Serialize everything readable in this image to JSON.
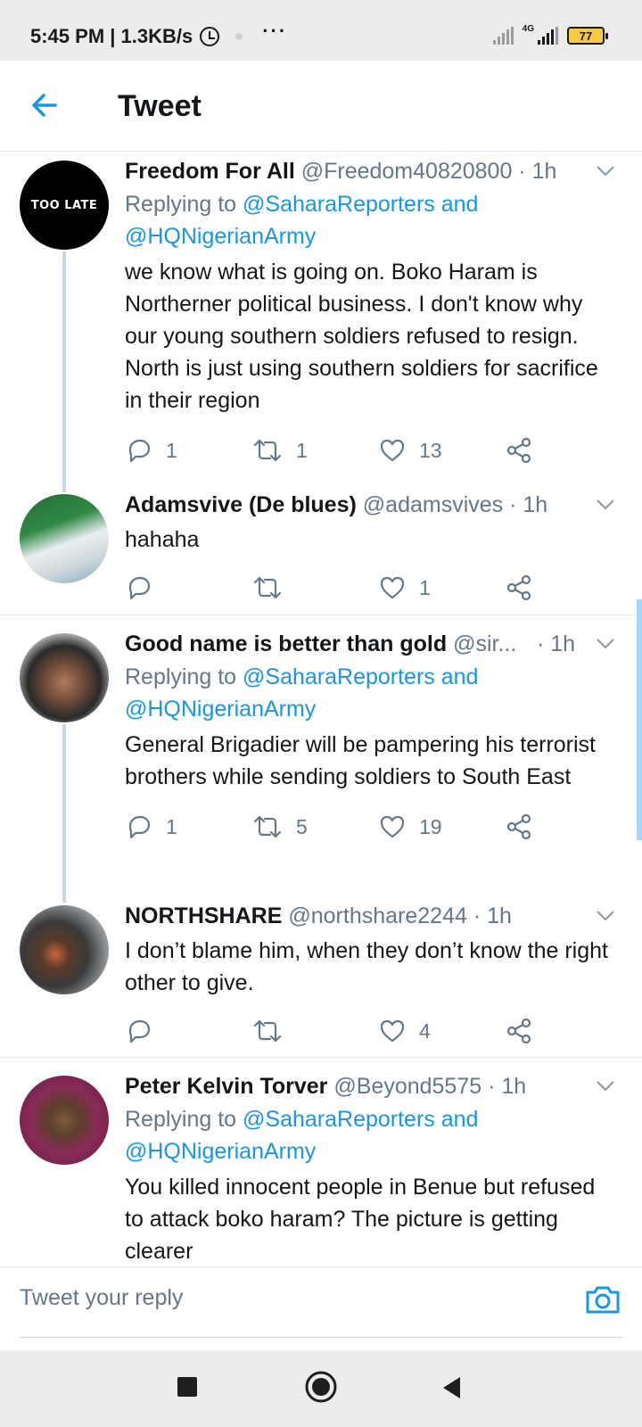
{
  "status_bar": {
    "time_speed": "5:45 PM | 1.3KB/s",
    "more": "···",
    "network": "4G",
    "battery": "77"
  },
  "header": {
    "title": "Tweet"
  },
  "tweets": [
    {
      "name": "Freedom For All",
      "handle": "@Freedom40820800 · 1h",
      "avatar_text": "TOO LATE",
      "replying_prefix": "Replying to",
      "replying_1": "@SaharaReporters and",
      "replying_2": "@HQNigerianArmy",
      "text": "we know what is going on. Boko Haram is Northerner political business. I don't know why our young southern soldiers refused to resign. North is just using southern soldiers for sacrifice in their region",
      "replies": "1",
      "retweets": "1",
      "likes": "13"
    },
    {
      "name": "Adamsvive (De blues)",
      "handle": "@adamsvives · 1h",
      "text": "hahaha",
      "replies": "",
      "retweets": "",
      "likes": "1"
    },
    {
      "name": "Good name is better than gold",
      "handle": "@sir...",
      "time": "· 1h",
      "replying_prefix": "Replying to",
      "replying_1": "@SaharaReporters and",
      "replying_2": "@HQNigerianArmy",
      "text": "General Brigadier will be pampering his terrorist brothers while sending soldiers to South East",
      "replies": "1",
      "retweets": "5",
      "likes": "19"
    },
    {
      "name": "NORTHSHARE",
      "handle": "@northshare2244 · 1h",
      "text": "I don’t blame him, when they don’t know the right other to give.",
      "replies": "",
      "retweets": "",
      "likes": "4"
    },
    {
      "name": "Peter Kelvin Torver",
      "handle": "@Beyond5575 · 1h",
      "replying_prefix": "Replying to",
      "replying_1": "@SaharaReporters and",
      "replying_2": "@HQNigerianArmy",
      "text": "You killed innocent people in Benue but refused to attack boko haram? The picture is getting clearer"
    }
  ],
  "composer": {
    "placeholder": "Tweet your reply"
  },
  "colors": {
    "accent": "#1b95e0",
    "secondary_text": "#657786",
    "thread_line": "#ccd6dd"
  },
  "icons": [
    "arrow-left-icon",
    "chevron-down-icon",
    "reply-icon",
    "retweet-icon",
    "like-icon",
    "share-icon",
    "camera-icon",
    "nav-square-icon",
    "nav-home-icon",
    "nav-back-icon"
  ]
}
